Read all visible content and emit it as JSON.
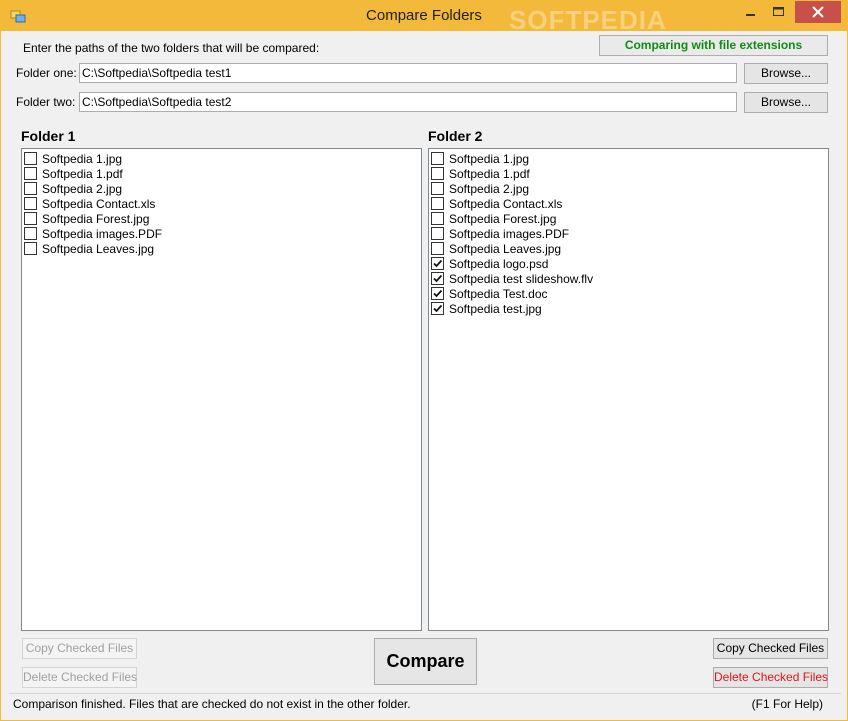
{
  "window": {
    "title": "Compare Folders",
    "watermark": "SOFTPEDIA"
  },
  "header": {
    "instruction": "Enter the paths of the two folders that will be compared:",
    "extensions_button": "Comparing with file extensions"
  },
  "folder_one": {
    "label": "Folder one:",
    "path": "C:\\Softpedia\\Softpedia test1",
    "browse_label": "Browse..."
  },
  "folder_two": {
    "label": "Folder two:",
    "path": "C:\\Softpedia\\Softpedia test2",
    "browse_label": "Browse..."
  },
  "list1": {
    "heading": "Folder 1",
    "items": [
      {
        "name": "Softpedia 1.jpg",
        "checked": false
      },
      {
        "name": "Softpedia 1.pdf",
        "checked": false
      },
      {
        "name": "Softpedia 2.jpg",
        "checked": false
      },
      {
        "name": "Softpedia Contact.xls",
        "checked": false
      },
      {
        "name": "Softpedia Forest.jpg",
        "checked": false
      },
      {
        "name": "Softpedia images.PDF",
        "checked": false
      },
      {
        "name": "Softpedia Leaves.jpg",
        "checked": false
      }
    ],
    "copy_label": "Copy Checked Files",
    "delete_label": "Delete Checked Files"
  },
  "list2": {
    "heading": "Folder 2",
    "items": [
      {
        "name": "Softpedia 1.jpg",
        "checked": false
      },
      {
        "name": "Softpedia 1.pdf",
        "checked": false
      },
      {
        "name": "Softpedia 2.jpg",
        "checked": false
      },
      {
        "name": "Softpedia Contact.xls",
        "checked": false
      },
      {
        "name": "Softpedia Forest.jpg",
        "checked": false
      },
      {
        "name": "Softpedia images.PDF",
        "checked": false
      },
      {
        "name": "Softpedia Leaves.jpg",
        "checked": false
      },
      {
        "name": "Softpedia logo.psd",
        "checked": true
      },
      {
        "name": "Softpedia test slideshow.flv",
        "checked": true
      },
      {
        "name": "Softpedia Test.doc",
        "checked": true
      },
      {
        "name": "Softpedia test.jpg",
        "checked": true
      }
    ],
    "copy_label": "Copy Checked Files",
    "delete_label": "Delete Checked Files"
  },
  "compare_label": "Compare",
  "status": {
    "message": "Comparison finished. Files that are checked do not exist in the other folder.",
    "help": "(F1 For Help)"
  },
  "colors": {
    "titlebar": "#f3b93a",
    "close_button": "#c7504b",
    "extensions_text": "#118a14",
    "delete_text": "#e0141b"
  },
  "icons": [
    "folders-icon",
    "minimize-icon",
    "maximize-icon",
    "close-icon",
    "checkmark-icon"
  ]
}
